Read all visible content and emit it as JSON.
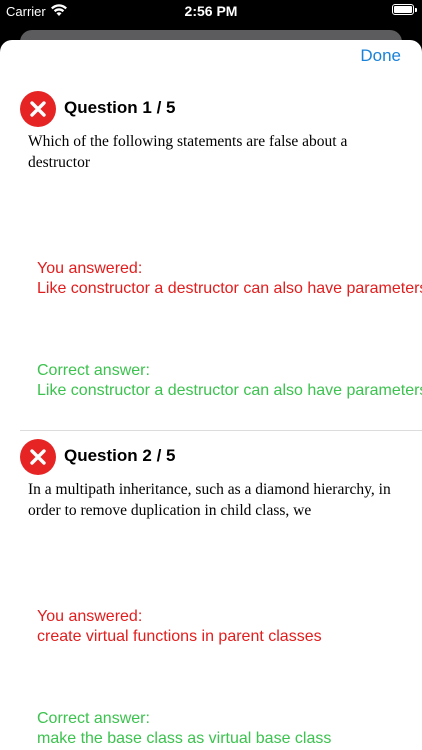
{
  "status_bar": {
    "carrier": "Carrier",
    "time": "2:56 PM"
  },
  "sheet": {
    "done_label": "Done"
  },
  "questions": [
    {
      "title": "Question 1 / 5",
      "text": "Which of the following statements are false about a destructor",
      "you_answered_label": "You answered:",
      "you_answered": "Like constructor a destructor can also have parameters",
      "correct_label": "Correct answer:",
      "correct_answer": "Like constructor a destructor can also have parameters"
    },
    {
      "title": "Question 2 / 5",
      "text": "In a multipath inheritance, such as a diamond hierarchy, in order to remove duplication in child class, we",
      "you_answered_label": "You answered:",
      "you_answered": "create virtual functions in parent classes",
      "correct_label": "Correct answer:",
      "correct_answer": "make the base class as virtual base class"
    }
  ],
  "colors": {
    "wrong": "#e21d1d",
    "correct": "#3cc24e",
    "accent": "#1a82d8",
    "incorrect_icon": "#e62424"
  },
  "icons": {
    "question_status": "x-circle-icon"
  }
}
